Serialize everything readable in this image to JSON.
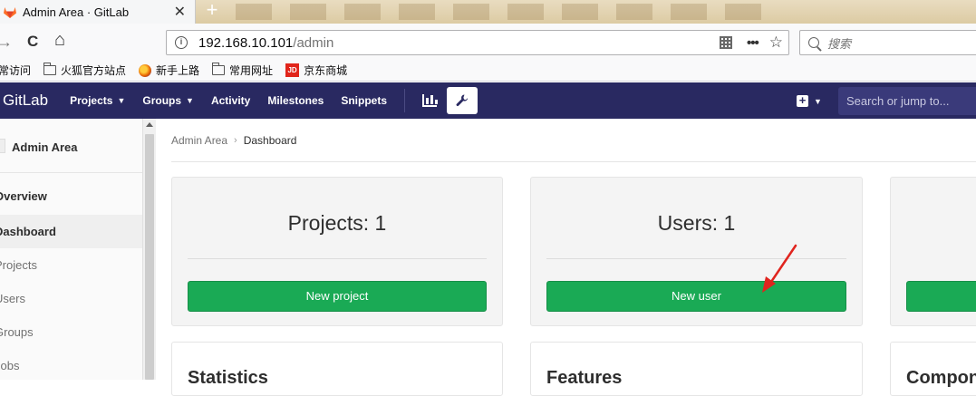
{
  "browser": {
    "tab_title": "Admin Area · GitLab",
    "tab_close": "✕",
    "new_tab": "+",
    "url_host": "192.168.10.101",
    "url_path": "/admin",
    "search_placeholder": "搜索",
    "nav": {
      "forward": "→",
      "reload": "C",
      "home": "⌂"
    },
    "bookmarks": [
      "常访问",
      "火狐官方站点",
      "新手上路",
      "常用网址",
      "京东商城"
    ],
    "jd_badge": "JD",
    "menu_dots": "•••",
    "star": "☆"
  },
  "gitlab": {
    "logo_text": "GitLab",
    "nav": [
      {
        "label": "Projects",
        "caret": true
      },
      {
        "label": "Groups",
        "caret": true
      },
      {
        "label": "Activity",
        "caret": false
      },
      {
        "label": "Milestones",
        "caret": false
      },
      {
        "label": "Snippets",
        "caret": false
      }
    ],
    "plus": "+",
    "search_placeholder": "Search or jump to..."
  },
  "sidebar": {
    "title": "Admin Area",
    "overview": "Overview",
    "items": [
      "Dashboard",
      "Projects",
      "Users",
      "Groups",
      "Jobs"
    ]
  },
  "breadcrumb": {
    "parent": "Admin Area",
    "separator": "›",
    "current": "Dashboard"
  },
  "cards": [
    {
      "count_label": "Projects: 1",
      "button": "New project"
    },
    {
      "count_label": "Users: 1",
      "button": "New user"
    },
    {
      "count_label": "",
      "button": ""
    }
  ],
  "lower_cards": [
    "Statistics",
    "Features",
    "Components"
  ],
  "colors": {
    "header": "#292961",
    "success": "#1aaa55",
    "annotation_arrow": "#e0241e"
  }
}
